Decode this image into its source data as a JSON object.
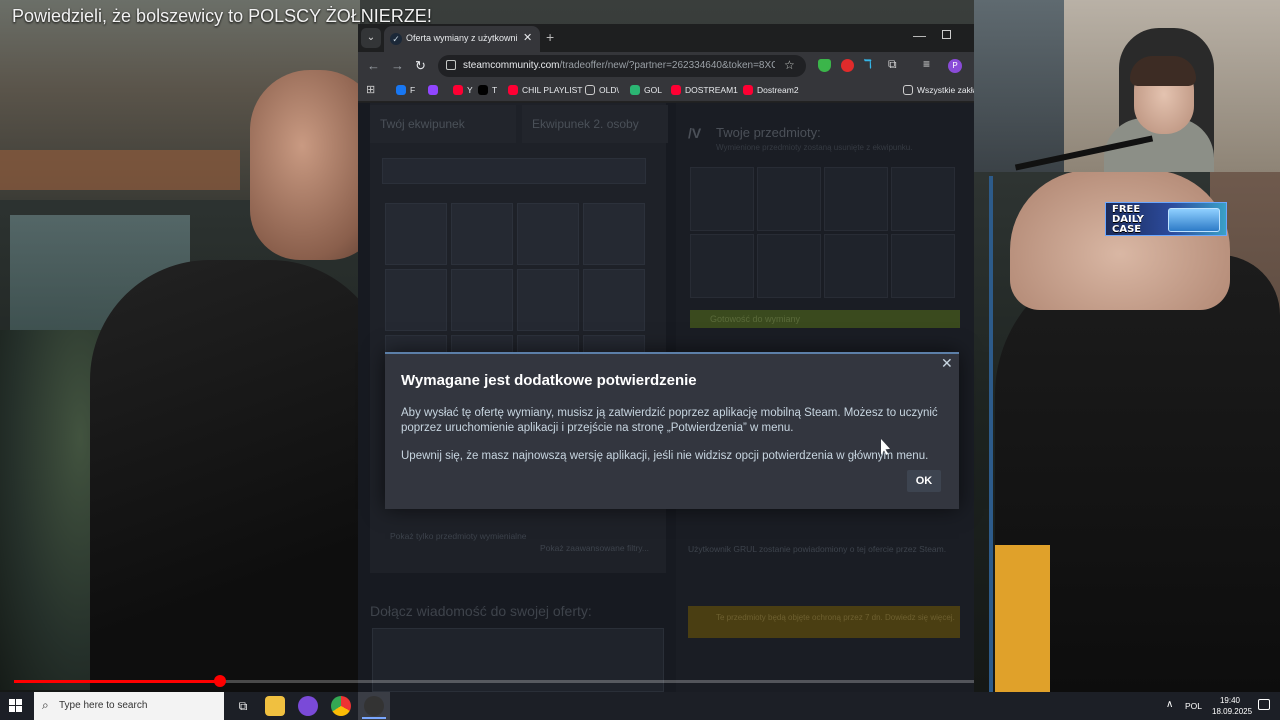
{
  "video": {
    "title": "Powiedzieli, że bolszewicy to POLSCY ŻOŁNIERZE!",
    "progress_fraction": 0.215
  },
  "promo": {
    "text": "FREE DAILY CASE"
  },
  "browser": {
    "tab_title": "Oferta wymiany z użytkownikiem",
    "tab_close_glyph": "✕",
    "new_tab_glyph": "+",
    "url_host": "steamcommunity.com",
    "url_path": "/tradeoffer/new/?partner=262334640&token=8XG...",
    "bookmarks": [
      {
        "label": "F",
        "color": "#1877f2"
      },
      {
        "label": "",
        "color": "#9146ff"
      },
      {
        "label": "Y",
        "color": "#ff0033"
      },
      {
        "label": "T",
        "color": "#000000"
      },
      {
        "label": "CHIL PLAYLIST",
        "color": "#ff0033"
      },
      {
        "label": "OLD\\",
        "color": "transparent"
      },
      {
        "label": "GOL",
        "color": "#2bb673"
      },
      {
        "label": "DOSTREAM1",
        "color": "#ff0033"
      },
      {
        "label": "Dostream2",
        "color": "#ff0033"
      },
      {
        "label": "Wszystkie zakła",
        "color": "transparent"
      }
    ]
  },
  "steam": {
    "tab_mine": "Twój ekwipunek",
    "tab_theirs": "Ekwipunek 2. osoby",
    "right_title": "Twoje przedmioty:",
    "right_subtitle": "Wymienione przedmioty zostaną usunięte z ekwipunku.",
    "ready_label": "Gotowość do wymiany",
    "note": "Użytkownik GRUL zostanie powiadomiony o tej ofercie przez Steam.",
    "warning": "Te przedmioty będą objęte ochroną przez 7 dn. Dowiedz się więcej.",
    "message_label": "Dołącz wiadomość do swojej oferty:",
    "filter_text": "Pokaż tylko przedmioty wymienialne",
    "filter_button": "Pokaż zaawansowane filtry..."
  },
  "dialog": {
    "title": "Wymagane jest dodatkowe potwierdzenie",
    "body1": "Aby wysłać tę ofertę wymiany, musisz ją zatwierdzić poprzez aplikację mobilną Steam. Możesz to uczynić poprzez uruchomienie aplikacji i przejście na stronę „Potwierdzenia” w menu.",
    "body2": "Upewnij się, że masz najnowszą wersję aplikacji, jeśli nie widzisz opcji potwierdzenia w głównym menu.",
    "ok_label": "OK",
    "close_glyph": "✕"
  },
  "taskbar": {
    "search_placeholder": "Type here to search",
    "language": "POL",
    "time": "19:40",
    "date": "18.09.2025"
  }
}
